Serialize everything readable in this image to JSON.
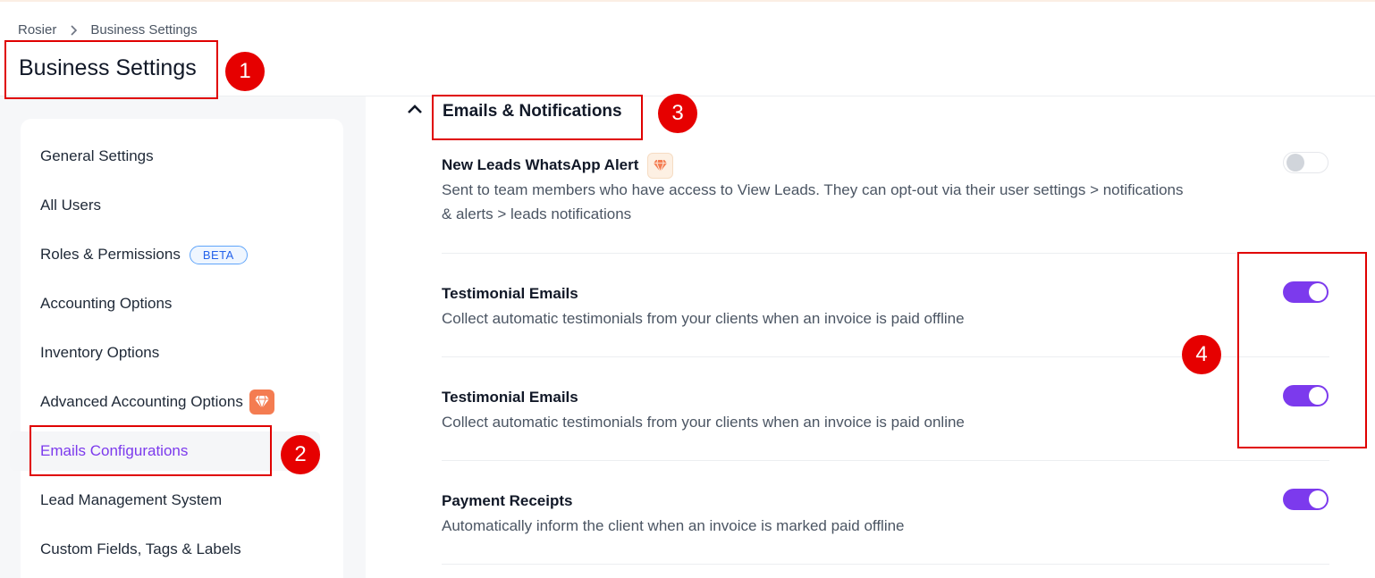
{
  "breadcrumb": {
    "root": "Rosier",
    "current": "Business Settings"
  },
  "page": {
    "title": "Business Settings"
  },
  "sidebar": {
    "items": [
      {
        "label": "General Settings"
      },
      {
        "label": "All Users"
      },
      {
        "label": "Roles & Permissions",
        "badge": "BETA"
      },
      {
        "label": "Accounting Options"
      },
      {
        "label": "Inventory Options"
      },
      {
        "label": "Advanced Accounting Options",
        "icon": "gem-icon"
      },
      {
        "label": "Emails Configurations",
        "active": true
      },
      {
        "label": "Lead Management System"
      },
      {
        "label": "Custom Fields, Tags & Labels"
      }
    ]
  },
  "section": {
    "title": "Emails & Notifications",
    "collapse_icon": "chevron-up-icon",
    "settings": [
      {
        "title": "New Leads WhatsApp Alert",
        "badge_icon": "gem-icon",
        "description": "Sent to team members who have access to View Leads. They can opt-out via their user settings > notifications & alerts > leads notifications",
        "enabled": false
      },
      {
        "title": "Testimonial Emails",
        "description": "Collect automatic testimonials from your clients when an invoice is paid offline",
        "enabled": true
      },
      {
        "title": "Testimonial Emails",
        "description": "Collect automatic testimonials from your clients when an invoice is paid online",
        "enabled": true
      },
      {
        "title": "Payment Receipts",
        "description": "Automatically inform the client when an invoice is marked paid offline",
        "enabled": true
      }
    ]
  },
  "annotations": [
    "1",
    "2",
    "3",
    "4"
  ],
  "colors": {
    "accent": "#7c3aed",
    "annotation": "#e60000",
    "beta": "#2563eb",
    "gem": "#f47c51"
  }
}
